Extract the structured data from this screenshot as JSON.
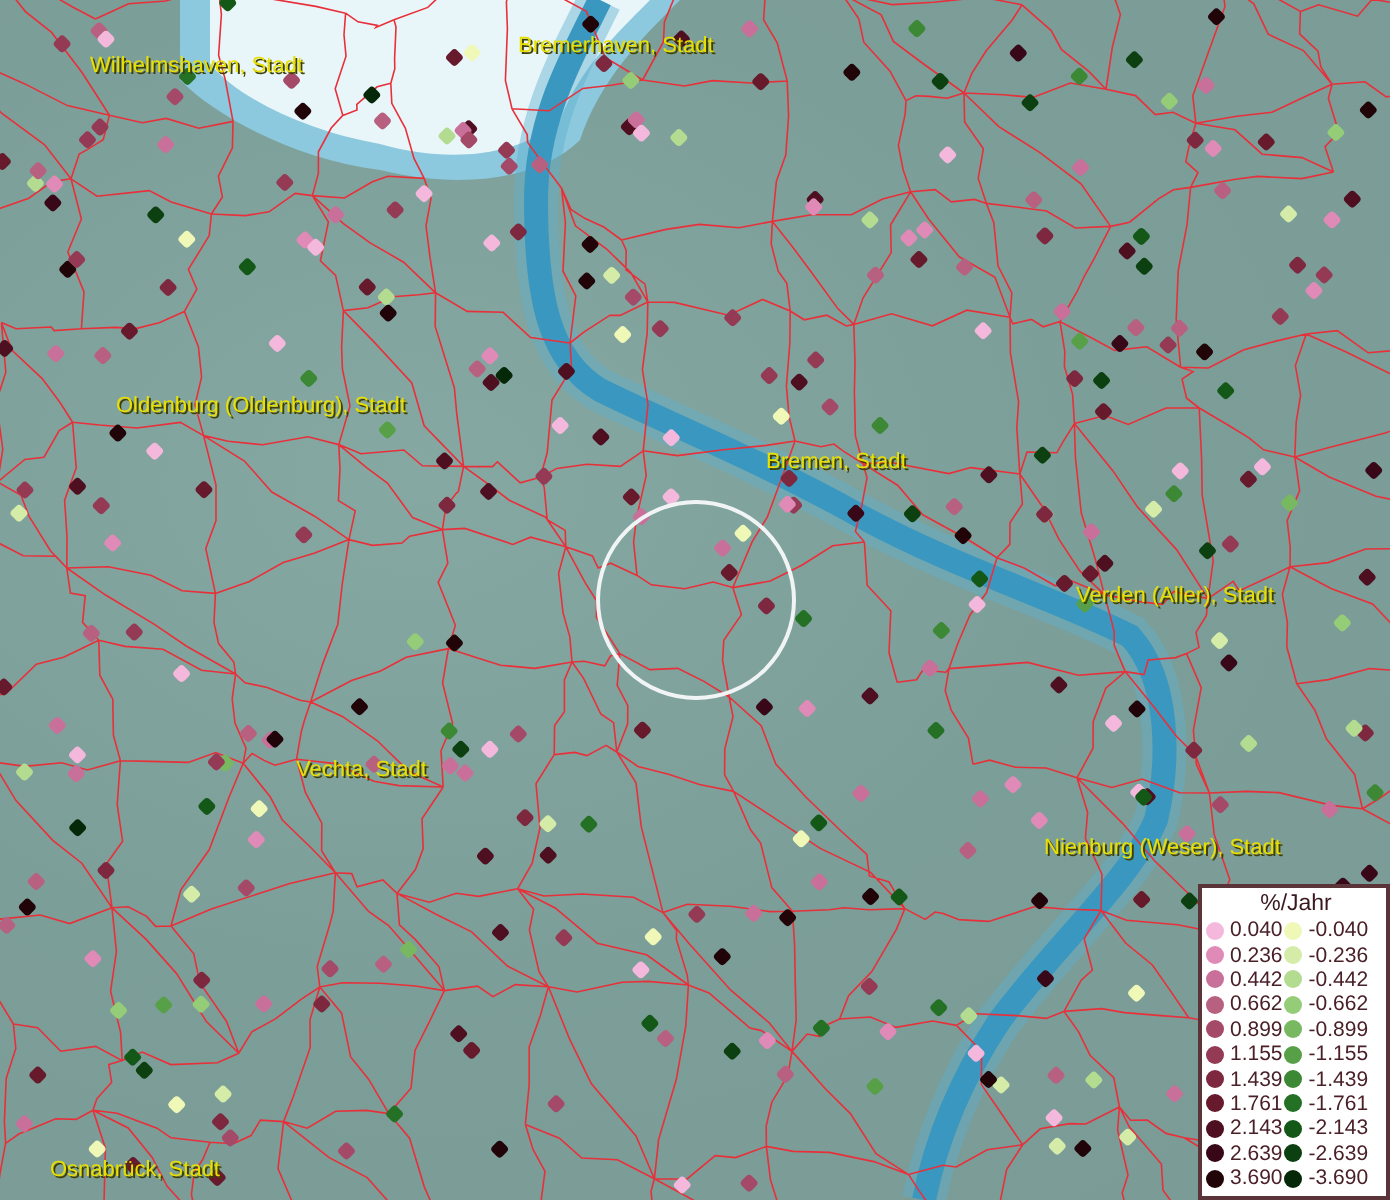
{
  "map": {
    "cities": [
      {
        "name": "Wilhelmshaven, Stadt"
      },
      {
        "name": "Bremerhaven, Stadt"
      },
      {
        "name": "Oldenburg (Oldenburg), Stadt"
      },
      {
        "name": "Bremen, Stadt"
      },
      {
        "name": "Verden (Aller), Stadt"
      },
      {
        "name": "Vechta, Stadt"
      },
      {
        "name": "Nienburg (Weser), Stadt"
      },
      {
        "name": "Osnabrück, Stadt"
      }
    ]
  },
  "legend": {
    "title": "%/Jahr",
    "increase": [
      {
        "value": "0.040",
        "color": "#f4b8dc"
      },
      {
        "value": "0.236",
        "color": "#e08ab8"
      },
      {
        "value": "0.442",
        "color": "#c8709a"
      },
      {
        "value": "0.662",
        "color": "#b8607f"
      },
      {
        "value": "0.899",
        "color": "#a44a68"
      },
      {
        "value": "1.155",
        "color": "#943a55"
      },
      {
        "value": "1.439",
        "color": "#7e2840"
      },
      {
        "value": "1.761",
        "color": "#661a2c"
      },
      {
        "value": "2.143",
        "color": "#4e1020"
      },
      {
        "value": "2.639",
        "color": "#380818"
      },
      {
        "value": "3.690",
        "color": "#200408"
      }
    ],
    "decrease": [
      {
        "value": "-0.040",
        "color": "#f0f8b8"
      },
      {
        "value": "-0.236",
        "color": "#d4eca8"
      },
      {
        "value": "-0.442",
        "color": "#b4dc90"
      },
      {
        "value": "-0.662",
        "color": "#94cc78"
      },
      {
        "value": "-0.899",
        "color": "#78b860"
      },
      {
        "value": "-1.155",
        "color": "#58a048"
      },
      {
        "value": "-1.439",
        "color": "#3c8834"
      },
      {
        "value": "-1.761",
        "color": "#247024"
      },
      {
        "value": "-2.143",
        "color": "#145818"
      },
      {
        "value": "-2.639",
        "color": "#0c4010"
      },
      {
        "value": "-3.690",
        "color": "#042808"
      }
    ]
  }
}
